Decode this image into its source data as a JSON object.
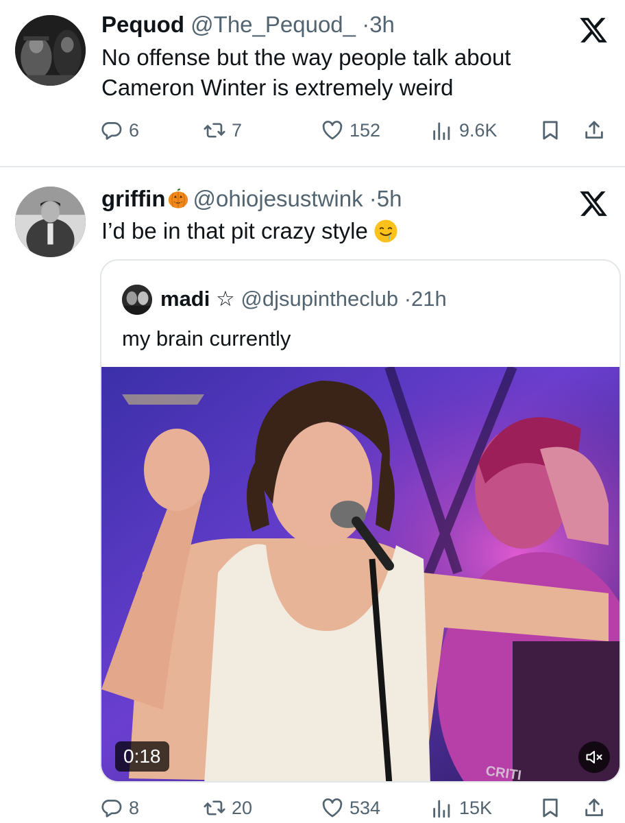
{
  "tweets": [
    {
      "name": "Pequod",
      "handle": "@The_Pequod_",
      "separator": "·",
      "time": "3h",
      "text": "No offense but the way people talk about Cameron Winter is extremely weird",
      "replies": "6",
      "reposts": "7",
      "likes": "152",
      "views": "9.6K"
    },
    {
      "name": "griffin",
      "handle": "@ohiojesustwink",
      "separator": "·",
      "time": "5h",
      "text": "I’d be in that pit crazy style",
      "replies": "8",
      "reposts": "20",
      "likes": "534",
      "views": "15K",
      "quote": {
        "name": "madi",
        "badge": "☆",
        "handle": "@djsupintheclub",
        "separator": "·",
        "time": "21h",
        "text": "my brain currently",
        "video_time": "0:18"
      }
    }
  ],
  "icons": {
    "brand": "x-logo",
    "reply": "reply-icon",
    "repost": "repost-icon",
    "like": "heart-icon",
    "views": "views-icon",
    "bookmark": "bookmark-icon",
    "share": "share-icon",
    "mute": "speaker-muted-icon"
  },
  "colors": {
    "text": "#0f1419",
    "secondary": "#536471",
    "divider": "#e6e9eb",
    "stage_purple": "#6a3fd0",
    "stage_pink": "#d24ec4"
  }
}
